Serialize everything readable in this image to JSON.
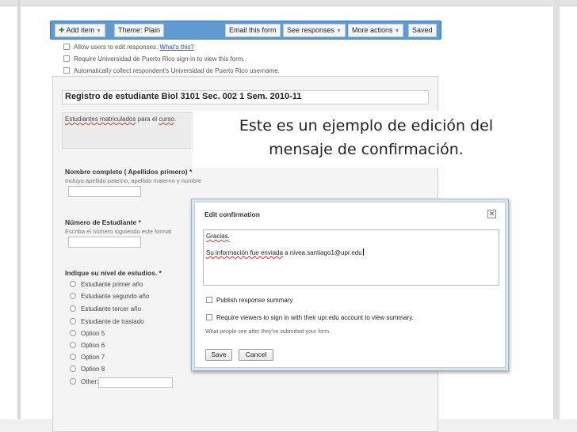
{
  "toolbar": {
    "add_item": "Add item",
    "theme": "Theme: Plain",
    "email": "Email this form",
    "see_responses": "See responses",
    "more_actions": "More actions",
    "saved": "Saved"
  },
  "options": {
    "allow_edit": "Allow users to edit responses.",
    "whats_this": "What's this?",
    "require_signin": "Require Universidad de Puerto Rico sign-in to view this form.",
    "auto_collect": "Automatically collect respondent's Universidad de Puerto Rico username."
  },
  "form": {
    "title": "Registro de estudiante Biol 3101 Sec. 002 1 Sem. 2010-11",
    "description": {
      "part1": "Estudiantes matriculados",
      "part2": " para el ",
      "part3": "curso",
      "part4": "."
    },
    "questions": [
      {
        "title": "Nombre completo ( Apellidos primero) *",
        "help": "Incluya apellido paterno, apellido materno y nombre"
      },
      {
        "title": "Número de Estudiante *",
        "help": "Escriba el número siguiendo este format"
      },
      {
        "title": "Indique su nivel de estudios. *",
        "help": ""
      }
    ],
    "choices": [
      "Estudiante primer año",
      "Estudiante segundo año",
      "Estudiante tercer año",
      "Estudiante de traslado",
      "Option 5",
      "Option 6",
      "Option 7",
      "Option 8",
      "Other:"
    ]
  },
  "caption": {
    "line1": "Este es un ejemplo de edición del",
    "line2": "mensaje de confirmación."
  },
  "dialog": {
    "title": "Edit confirmation",
    "close_icon": "close-icon",
    "text_line1": "Gracias.",
    "text_line2_a": "Su información fue enviada",
    "text_line2_b": " a nivea.santiago1@upr.edu",
    "publish_summary": "Publish response summary",
    "require_viewers": "Require viewers to sign in with their upr.edu account to view summary.",
    "help": "What people see after they've submitted your form.",
    "save": "Save",
    "cancel": "Cancel"
  }
}
